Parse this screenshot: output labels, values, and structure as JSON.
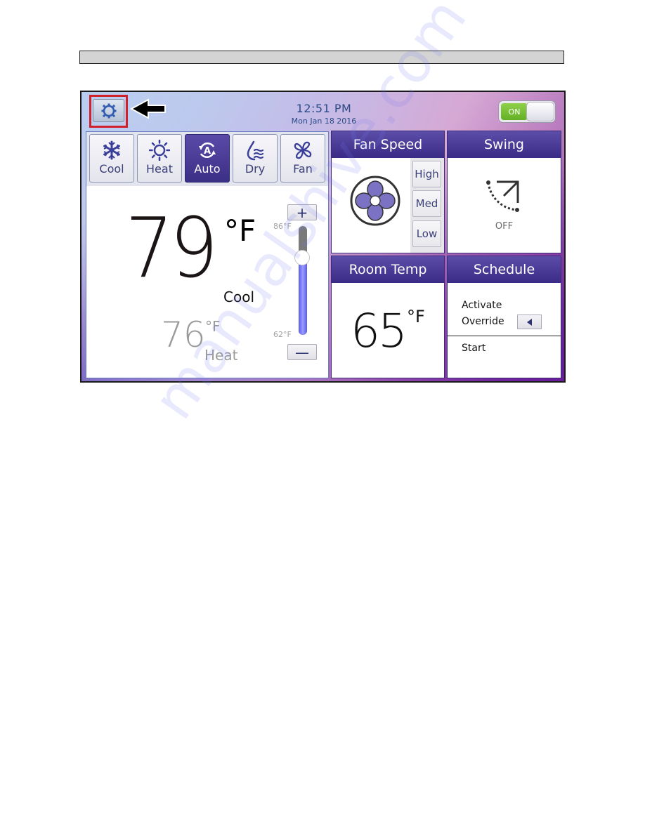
{
  "header_bar": {},
  "screen": {
    "clock": {
      "time": "12:51 PM",
      "date": "Mon Jan 18 2016"
    },
    "power": {
      "label": "ON",
      "state": "on",
      "color": "#6fbd2f"
    },
    "settings": {
      "icon": "gear-icon",
      "highlighted": true,
      "highlight_color": "#d0202a",
      "callout": "arrow-left-icon"
    },
    "modes": [
      {
        "label": "Cool",
        "icon": "snowflake-icon",
        "active": false
      },
      {
        "label": "Heat",
        "icon": "sun-icon",
        "active": false
      },
      {
        "label": "Auto",
        "icon": "auto-cycle-icon",
        "active": true
      },
      {
        "label": "Dry",
        "icon": "water-drop-icon",
        "active": false
      },
      {
        "label": "Fan",
        "icon": "fan-icon",
        "active": false
      }
    ],
    "setpoint": {
      "primary_value": "79",
      "primary_unit": "°F",
      "primary_mode": "Cool",
      "secondary_value": "76",
      "secondary_unit": "°F",
      "secondary_mode": "Heat",
      "increase_label": "+",
      "decrease_label": "—",
      "scale_max": "86°F",
      "scale_min": "62°F",
      "slider_min": 62,
      "slider_max": 86,
      "slider_value": 79
    },
    "fan_speed": {
      "title": "Fan Speed",
      "options": [
        "High",
        "Med",
        "Low"
      ],
      "icon": "fan-icon",
      "accent": "#7b72c4"
    },
    "swing": {
      "title": "Swing",
      "status": "OFF",
      "icon": "swing-icon"
    },
    "room_temp": {
      "title": "Room Temp",
      "value": "65",
      "unit": "°F"
    },
    "schedule": {
      "title": "Schedule",
      "activate_label": "Activate",
      "override_label": "Override",
      "start_label": "Start"
    },
    "colors": {
      "header": "#4a3c98",
      "active_mode": "#4a3c98",
      "clock_text": "#2b4a86"
    }
  },
  "watermark": "manualshive.com"
}
